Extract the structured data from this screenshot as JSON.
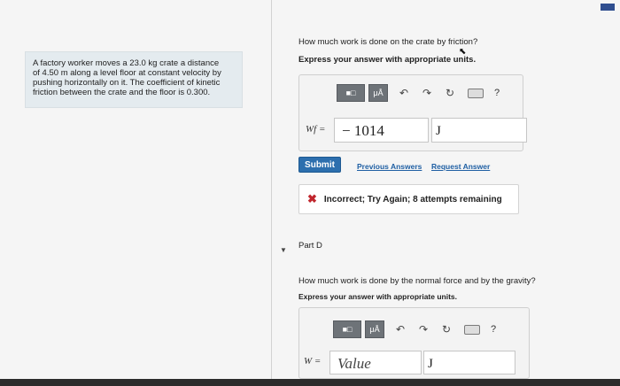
{
  "problem": {
    "text_lines": [
      "A factory worker moves a 23.0 kg crate a distance",
      "of 4.50 m along a level floor at constant velocity by",
      "pushing horizontally on it. The coefficient of kinetic",
      "friction between the crate and the floor is 0.300."
    ]
  },
  "partC": {
    "question": "How much work is done on the crate by friction?",
    "instruction": "Express your answer with appropriate units.",
    "variable_label": "Wf =",
    "value": "− 1014",
    "unit": "J",
    "toolbar": {
      "template_icon": "template-grid-icon",
      "units_label": "μÅ",
      "help_label": "?"
    },
    "submit_label": "Submit",
    "previous_answers_label": "Previous Answers",
    "request_answer_label": "Request Answer",
    "feedback": "Incorrect; Try Again; 8 attempts remaining",
    "feedback_color": "#c0262d"
  },
  "partD": {
    "label": "Part D",
    "question": "How much work is done by the normal force and by the gravity?",
    "instruction": "Express your answer with appropriate units.",
    "variable_label": "W =",
    "value_placeholder": "Value",
    "unit": "J",
    "toolbar": {
      "units_label": "μÅ",
      "help_label": "?"
    }
  },
  "colors": {
    "submit_bg": "#2d6fae",
    "link": "#1f5fa3",
    "problem_bg": "#e4ebef"
  }
}
